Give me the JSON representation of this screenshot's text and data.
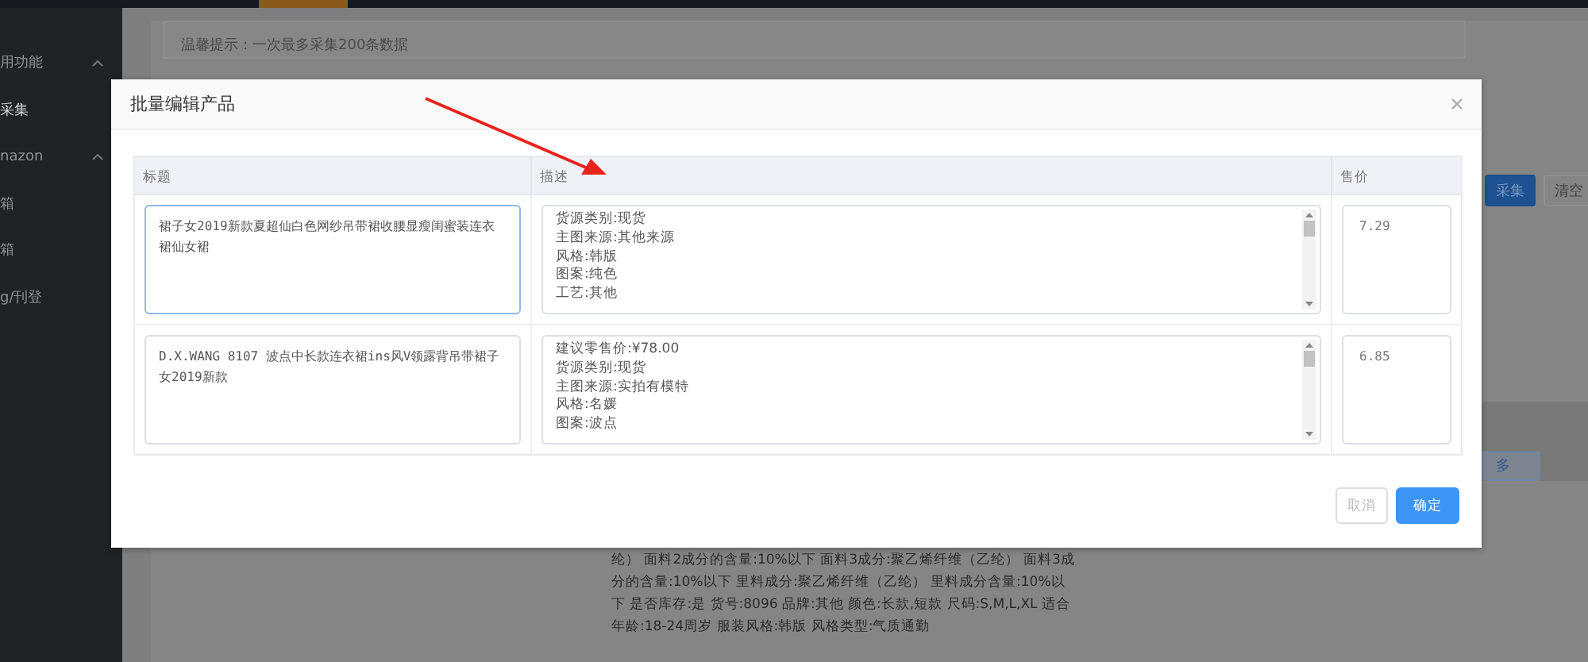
{
  "sidebar": {
    "items": [
      {
        "label": "用功能",
        "expandable": true,
        "selected": false
      },
      {
        "label": "采集",
        "expandable": false,
        "selected": true
      },
      {
        "label": "nazon",
        "expandable": true,
        "selected": false
      },
      {
        "label": "箱",
        "expandable": false,
        "selected": false
      },
      {
        "label": "箱",
        "expandable": false,
        "selected": false
      },
      {
        "label": "g/刊登",
        "expandable": false,
        "selected": false
      }
    ]
  },
  "background": {
    "tip": "温馨提示：一次最多采集200条数据",
    "buttons": [
      {
        "label": "采集",
        "kind": "primary"
      },
      {
        "label": "清空",
        "kind": "default"
      }
    ],
    "more_button": "多",
    "description_lines": [
      "纶） 面料2成分的含量:10%以下 面料3成分:聚乙烯纤维（乙纶） 面料3成",
      "分的含量:10%以下 里料成分:聚乙烯纤维（乙纶） 里料成分含量:10%以",
      "下 是否库存:是 货号:8096 品牌:其他 颜色:长款,短款 尺码:S,M,L,XL 适合",
      "年龄:18-24周岁 服装风格:韩版 风格类型:气质通勤"
    ]
  },
  "dialog": {
    "title": "批量编辑产品",
    "columns": [
      "标题",
      "描述",
      "售价"
    ],
    "rows": [
      {
        "title": "裙子女2019新款夏超仙白色网纱吊带裙收腰显瘦闺蜜装连衣裙仙女裙",
        "focused": true,
        "description": [
          "货源类别:现货",
          "主图来源:其他来源",
          "风格:韩版",
          "图案:纯色",
          "工艺:其他"
        ],
        "price": "7.29"
      },
      {
        "title": "D.X.WANG 8107 波点中长款连衣裙ins风V领露背吊带裙子女2019新款",
        "focused": false,
        "description": [
          "建议零售价:¥78.00",
          "货源类别:现货",
          "主图来源:实拍有模特",
          "风格:名媛",
          "图案:波点"
        ],
        "price": "6.85"
      }
    ],
    "buttons": [
      {
        "label": "取消",
        "kind": "default"
      },
      {
        "label": "确定",
        "kind": "primary"
      }
    ]
  }
}
